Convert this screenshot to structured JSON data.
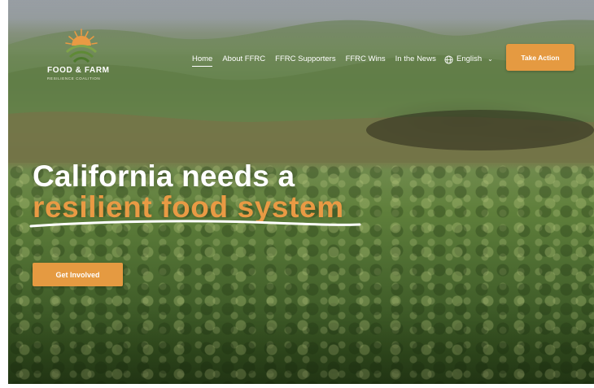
{
  "brand": {
    "name": "FOOD & FARM",
    "subtitle": "RESILIENCE COALITION"
  },
  "nav": {
    "items": [
      "Home",
      "About FFRC",
      "FFRC Supporters",
      "FFRC Wins",
      "In the News"
    ],
    "active_index": 0,
    "language": "English",
    "language_icon": "globe-icon",
    "cta": "Take Action"
  },
  "hero": {
    "headline_line1": "California needs a",
    "headline_line2": "resilient food system",
    "cta": "Get Involved"
  },
  "colors": {
    "accent": "#e59a41",
    "headline_accent": "#e99a44",
    "text": "#ffffff"
  }
}
